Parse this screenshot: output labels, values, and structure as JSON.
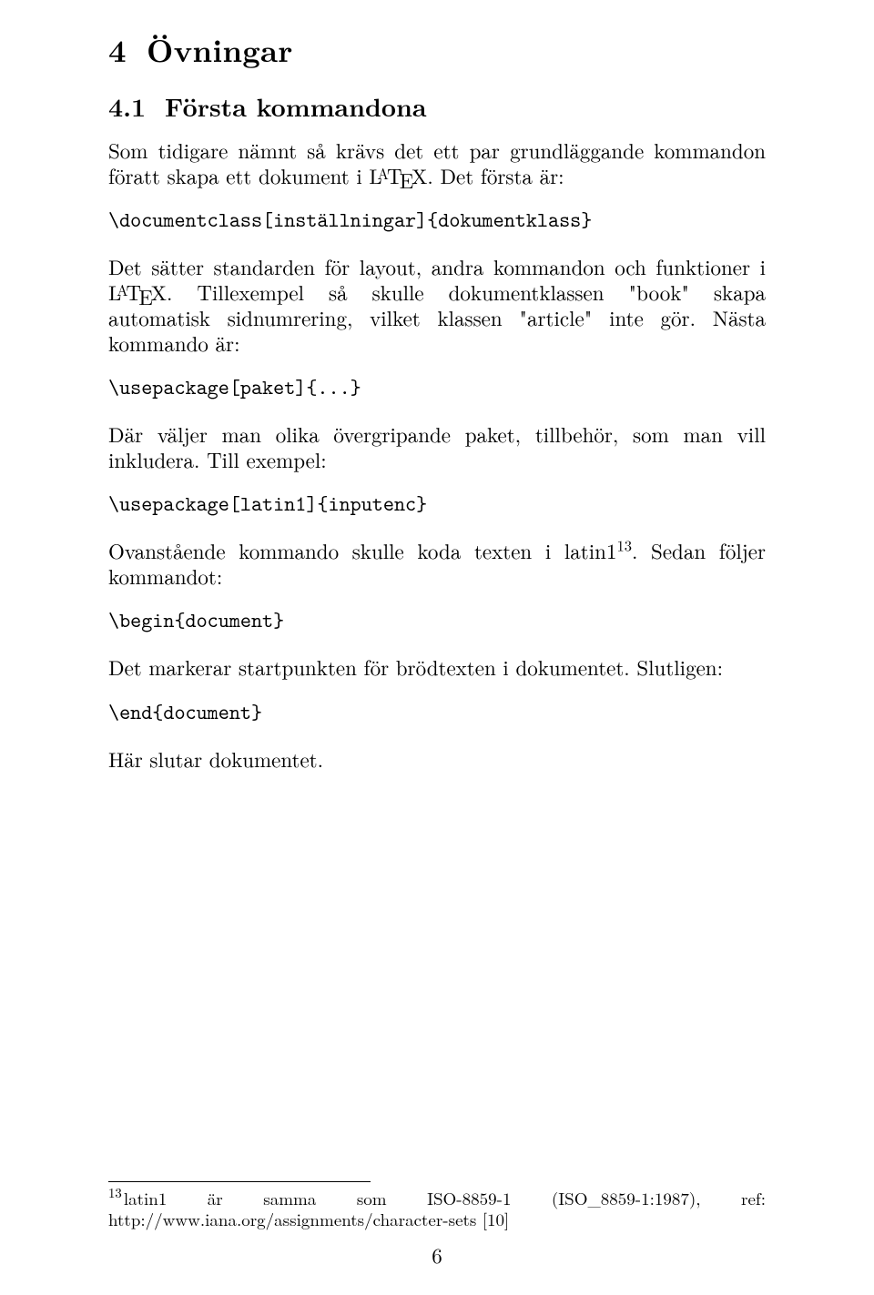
{
  "section": {
    "number": "4",
    "title": "Övningar"
  },
  "subsection": {
    "number": "4.1",
    "title": "Första kommandona"
  },
  "para1a": "Som tidigare nämnt så krävs det ett par grundläggande kommandon föratt skapa ett dokument i ",
  "para1b": ". Det första är:",
  "code1": "\\documentclass[inställningar]{dokumentklass}",
  "para2a": "Det sätter standarden för layout, andra kommandon och funktioner i ",
  "para2b": ". Tillexempel så skulle dokumentklassen \"book\" skapa automatisk sidnumrering, vilket klassen \"article\" inte gör. Nästa kommando är:",
  "code2": "\\usepackage[paket]{...}",
  "para3": "Där väljer man olika övergripande paket, tillbehör, som man vill inkludera. Till exempel:",
  "code3": "\\usepackage[latin1]{inputenc}",
  "para4a": "Ovanstående kommando skulle koda texten i latin1",
  "fnref": "13",
  "para4b": ". Sedan följer kommandot:",
  "code4": "\\begin{document}",
  "para5": "Det markerar startpunkten för brödtexten i dokumentet. Slutligen:",
  "code5": "\\end{document}",
  "para6": "Här slutar dokumentet.",
  "footnote": {
    "mark": "13",
    "text": "latin1 är samma som ISO-8859-1 (ISO_8859-1:1987), ref: http://www.iana.org/assignments/character-sets [10]"
  },
  "pageNumber": "6"
}
